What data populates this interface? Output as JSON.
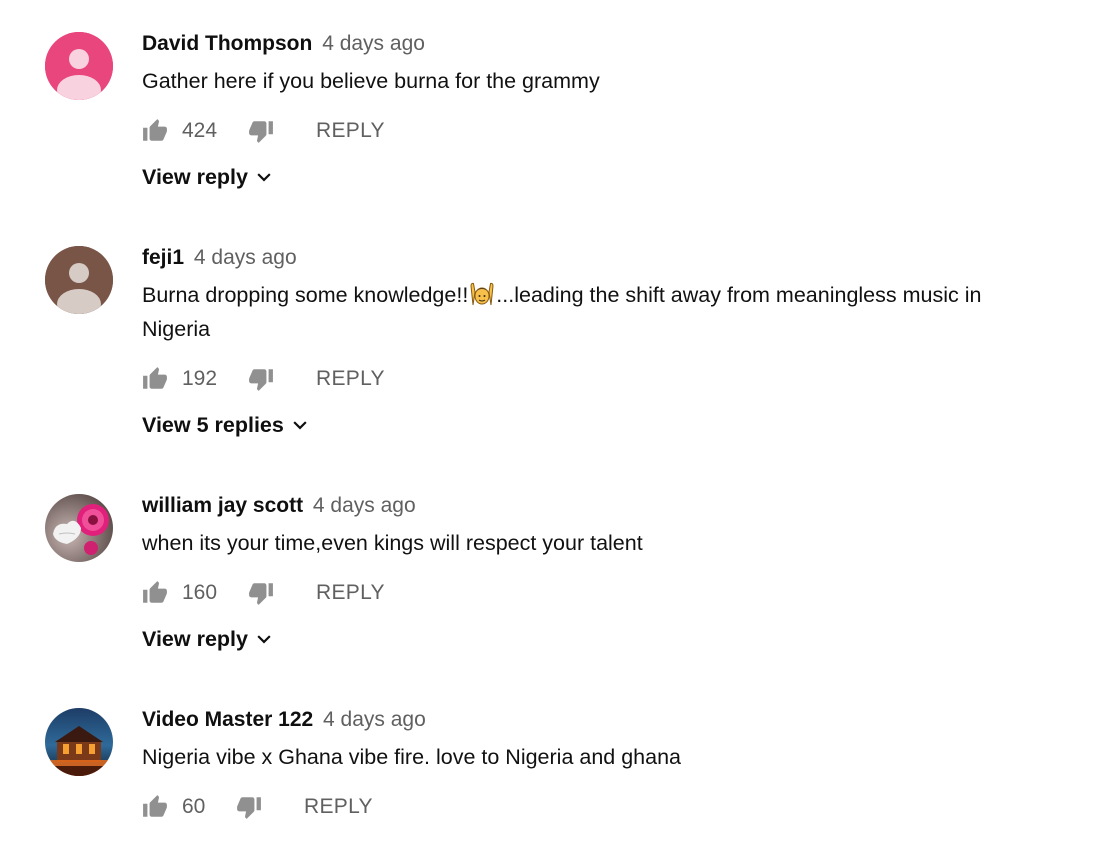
{
  "comments": [
    {
      "author": "David Thompson",
      "time": "4 days ago",
      "text": "Gather here if you believe burna for the grammy",
      "likes": "424",
      "reply_label": "REPLY",
      "view_replies": "View reply",
      "avatar": "default-person-pink"
    },
    {
      "author": "feji1",
      "time": "4 days ago",
      "text_before": "Burna dropping some knowledge!!",
      "emoji": "person-raising-hands",
      "text_after": "...leading the shift away from meaningless music in Nigeria",
      "likes": "192",
      "reply_label": "REPLY",
      "view_replies": "View 5 replies",
      "avatar": "default-person-brown"
    },
    {
      "author": "william jay scott",
      "time": "4 days ago",
      "text": "when its your time,even kings will respect your talent",
      "likes": "160",
      "reply_label": "REPLY",
      "view_replies": "View reply",
      "avatar": "photo-flower-heart"
    },
    {
      "author": "Video Master 122",
      "time": "4 days ago",
      "text": "Nigeria vibe x Ghana vibe fire. love to Nigeria and ghana",
      "likes": "60",
      "reply_label": "REPLY",
      "avatar": "photo-temple-night"
    }
  ],
  "icons": {
    "like": "thumb-up-icon",
    "dislike": "thumb-down-icon",
    "expand": "chevron-down-icon"
  },
  "colors": {
    "muted": "#606060",
    "avatar_pink": "#e8467c",
    "avatar_brown": "#795548"
  }
}
